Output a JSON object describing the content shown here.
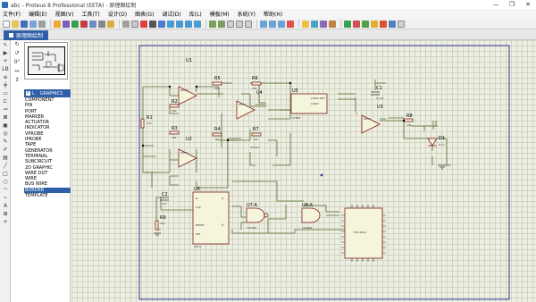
{
  "window": {
    "title": "abc - Proteus 8 Professional (EETA) - 原理图绘制",
    "controls": [
      "—",
      "❐",
      "✕"
    ]
  },
  "menu": [
    "文件(F)",
    "编辑(E)",
    "视图(V)",
    "工具(T)",
    "设计(D)",
    "图表(G)",
    "调试(D)",
    "库(L)",
    "模板(M)",
    "系统(Y)",
    "帮助(H)"
  ],
  "tab": {
    "label": "原理图绘制"
  },
  "panel": {
    "head_p": "P",
    "head_l": "L",
    "head_title": "GRAPHICS",
    "modes": [
      "COMPONENT",
      "PIN",
      "PORT",
      "MARKER",
      "ACTUATOR",
      "INDICATOR",
      "VPROBE",
      "IPROBE",
      "TAPE",
      "GENERATOR",
      "TERMINAL",
      "SUBCIRCUIT",
      "2D GRAPHIC",
      "WIRE DOT",
      "WIRE",
      "BUS WIRE",
      "BORDER",
      "TEMPLATE"
    ],
    "selected_mode": "BORDER",
    "rotation": "0°"
  },
  "schematic": {
    "components": [
      {
        "ref": "U1",
        "value": "OP07"
      },
      {
        "ref": "U2",
        "value": "OP07"
      },
      {
        "ref": "U3",
        "value": "OP07"
      },
      {
        "ref": "U4",
        "value": "OP07"
      },
      {
        "ref": "U5",
        "value": "LF398"
      },
      {
        "ref": "U6",
        "value": "4013"
      },
      {
        "ref": "U7:A",
        "value": "74LS00"
      },
      {
        "ref": "U8:A",
        "value": "74LS08"
      },
      {
        "ref": "U9",
        "value": "MC14451"
      },
      {
        "ref": "R1",
        "value": "10k"
      },
      {
        "ref": "R2",
        "value": "10k"
      },
      {
        "ref": "R3",
        "value": "10k"
      },
      {
        "ref": "R4",
        "value": "10k"
      },
      {
        "ref": "R5",
        "value": "10k"
      },
      {
        "ref": "R6",
        "value": "10k"
      },
      {
        "ref": "R7",
        "value": "10k"
      },
      {
        "ref": "R8",
        "value": "10k"
      },
      {
        "ref": "R9",
        "value": "10k"
      },
      {
        "ref": "C1",
        "value": "0.1uF"
      },
      {
        "ref": "C2",
        "value": "1uF"
      },
      {
        "ref": "D1",
        "value": "5.1V"
      }
    ],
    "u5_pins": [
      "LOGIC REF",
      "LOGIC"
    ],
    "u6_pins": [
      "D",
      "CLK",
      "Q",
      "RESET",
      "SET",
      "Q̅"
    ]
  }
}
